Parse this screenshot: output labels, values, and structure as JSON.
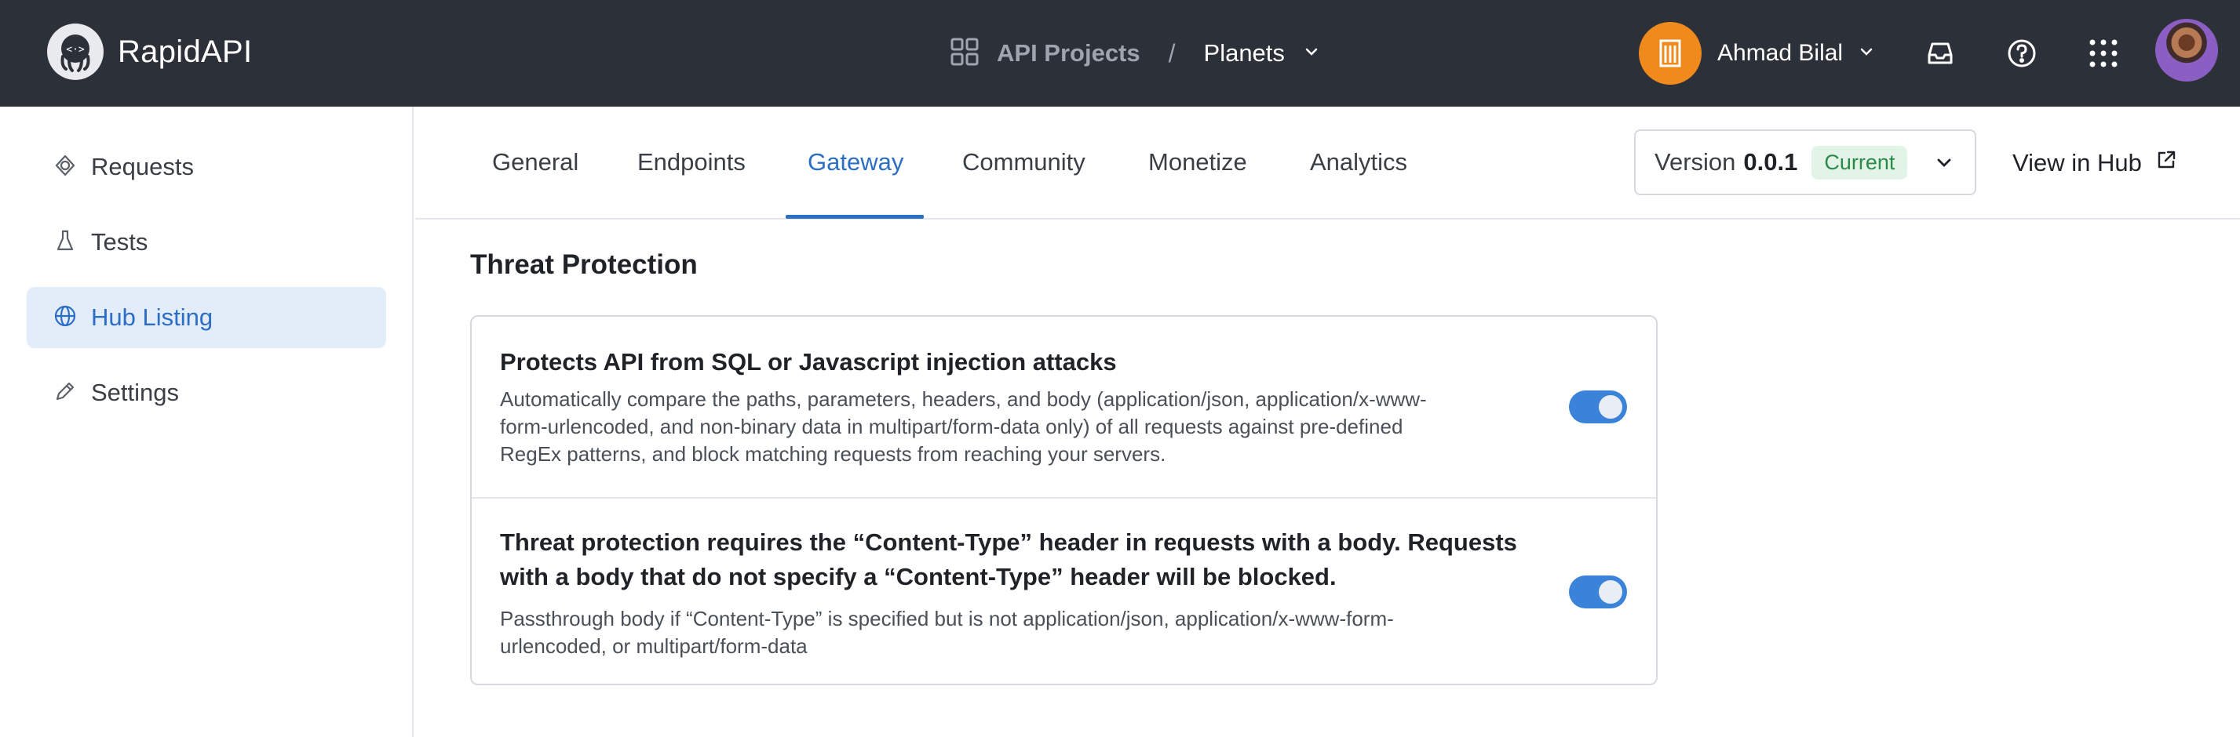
{
  "brand": {
    "name": "RapidAPI"
  },
  "breadcrumb": {
    "projects": "API Projects",
    "separator": "/",
    "current": "Planets"
  },
  "user": {
    "name": "Ahmad Bilal"
  },
  "sidebar": {
    "items": [
      {
        "label": "Requests",
        "icon": "requests-icon",
        "active": false
      },
      {
        "label": "Tests",
        "icon": "flask-icon",
        "active": false
      },
      {
        "label": "Hub Listing",
        "icon": "globe-icon",
        "active": true
      },
      {
        "label": "Settings",
        "icon": "pencil-icon",
        "active": false
      }
    ]
  },
  "tabs": [
    {
      "label": "General",
      "active": false
    },
    {
      "label": "Endpoints",
      "active": false
    },
    {
      "label": "Gateway",
      "active": true
    },
    {
      "label": "Community",
      "active": false
    },
    {
      "label": "Monetize",
      "active": false
    },
    {
      "label": "Analytics",
      "active": false
    }
  ],
  "version": {
    "label": "Version",
    "number": "0.0.1",
    "badge": "Current"
  },
  "view_hub": {
    "label": "View in Hub"
  },
  "section": {
    "title": "Threat Protection",
    "rows": [
      {
        "title": "Protects API from SQL or Javascript injection attacks",
        "description_lines": [
          "Automatically compare the paths, parameters, headers, and body (application/json, application/x-www-",
          "form-urlencoded, and non-binary data in multipart/form-data only) of all requests against pre-defined",
          "RegEx patterns, and block matching requests from reaching your servers."
        ],
        "enabled": true
      },
      {
        "title_lines": [
          "Threat protection requires the “Content-Type” header in requests with a body. Requests",
          "with a body that do not specify a “Content-Type” header will be blocked."
        ],
        "description_lines": [
          "Passthrough body if “Content-Type” is specified but is not application/json, application/x-www-form-",
          "urlencoded, or multipart/form-data"
        ],
        "enabled": true
      }
    ]
  },
  "colors": {
    "topbar": "#2b3039",
    "accent": "#2d6ec5",
    "toggle_on": "#3b82d9",
    "badge_text": "#2b8a48",
    "badge_bg": "#e2f4e7"
  }
}
